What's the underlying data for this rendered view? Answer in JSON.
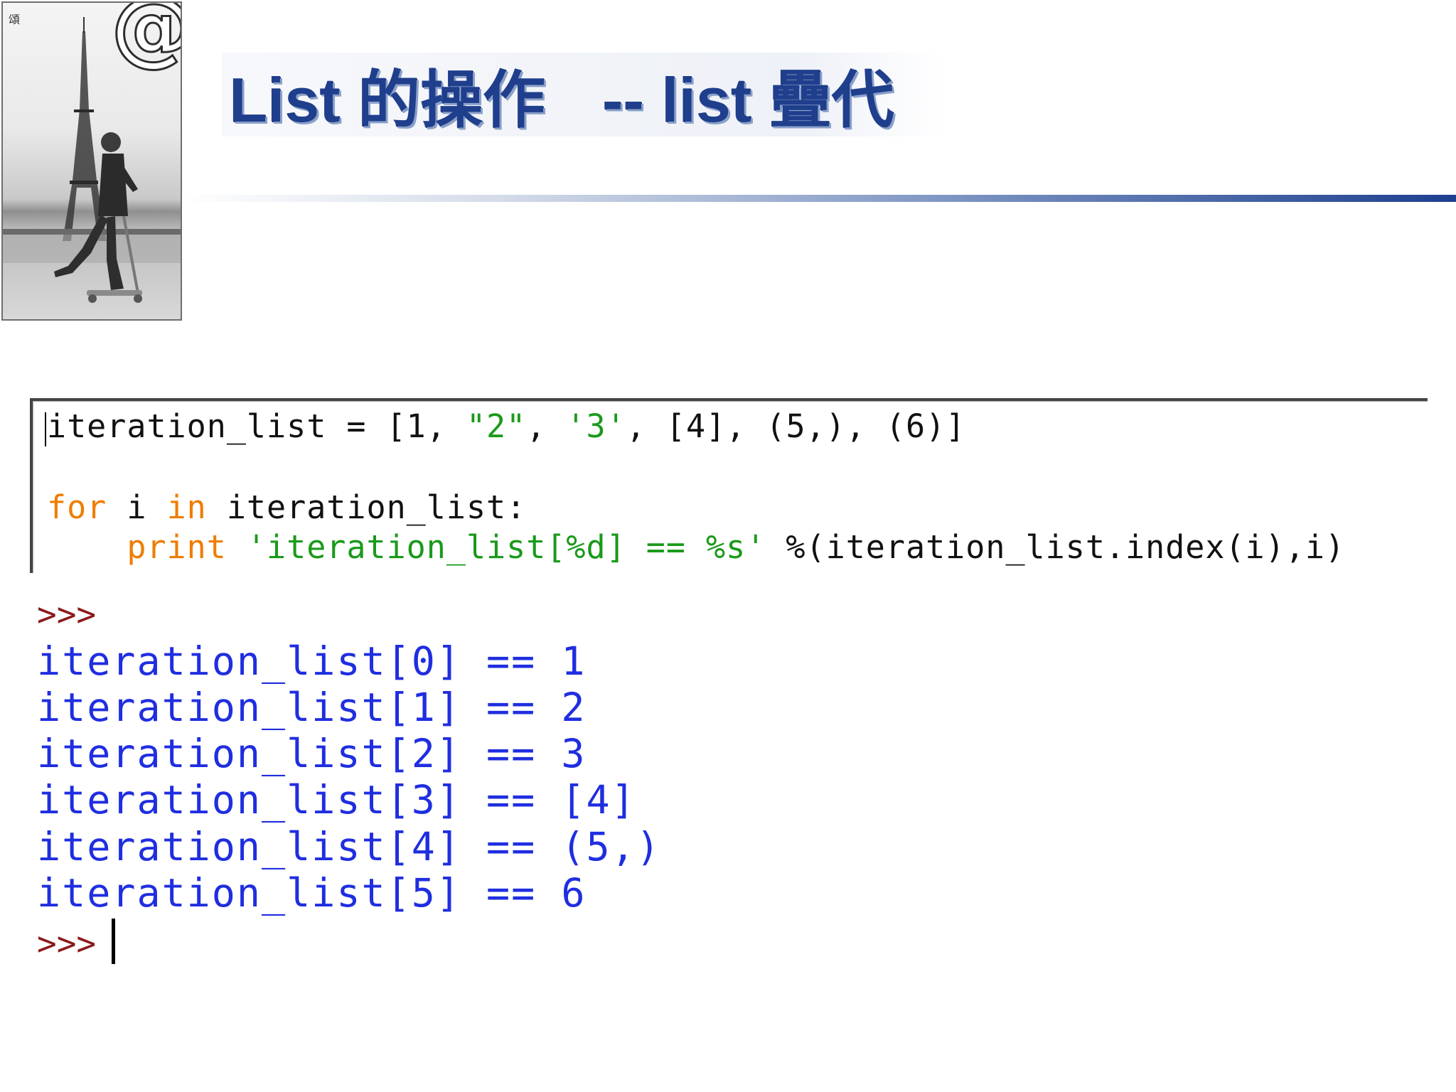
{
  "photo": {
    "corner_mark": "頌",
    "logo_text": "@"
  },
  "slide": {
    "title_left": "List 的操作",
    "title_right": "-- list 疊代"
  },
  "editor": {
    "line1": {
      "text_a": "iteration_list = [1, ",
      "str1": "\"2\"",
      "text_b": ", ",
      "str2": "'3'",
      "text_c": ", [4], (5,), (6)]"
    },
    "line3": {
      "kw1": "for",
      "text_a": " i ",
      "kw2": "in",
      "text_b": " iteration_list:"
    },
    "line4": {
      "indent": "    ",
      "kw": "print",
      "space": " ",
      "str": "'iteration_list[%d] == %s'",
      "text": " %(iteration_list.index(i),i)"
    }
  },
  "shell": {
    "prompt": ">>>",
    "output": [
      "iteration_list[0] == 1",
      "iteration_list[1] == 2",
      "iteration_list[2] == 3",
      "iteration_list[3] == [4]",
      "iteration_list[4] == (5,)",
      "iteration_list[5] == 6"
    ]
  },
  "colors": {
    "title": "#1f3e8c",
    "keyword": "#ee7d00",
    "string": "#1a9a1a",
    "output": "#1f2ee0",
    "prompt": "#8b1a1a"
  }
}
